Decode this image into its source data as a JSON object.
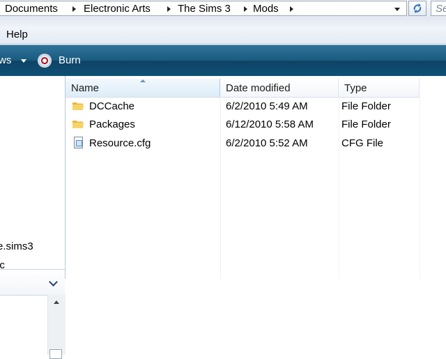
{
  "breadcrumb": [
    "Documents",
    "Electronic Arts",
    "The Sims 3",
    "Mods"
  ],
  "search": {
    "placeholder": "Se"
  },
  "menu": {
    "items": [
      "Help"
    ]
  },
  "toolbar": {
    "views_partial": "ws",
    "burn_label": "Burn"
  },
  "nav": {
    "items": [
      "e.sims3",
      "ic"
    ]
  },
  "columns": {
    "name": "Name",
    "date": "Date modified",
    "type": "Type"
  },
  "files": [
    {
      "name": "DCCache",
      "date": "6/2/2010 5:49 AM",
      "type": "File Folder",
      "icon": "folder-icon"
    },
    {
      "name": "Packages",
      "date": "6/12/2010 5:58 AM",
      "type": "File Folder",
      "icon": "folder-icon"
    },
    {
      "name": "Resource.cfg",
      "date": "6/2/2010 5:52 AM",
      "type": "CFG File",
      "icon": "file-icon"
    }
  ],
  "colors": {
    "toolbar": "#1b5b80",
    "header_highlight": "#dcecf8",
    "folder": "#f2c94c"
  }
}
